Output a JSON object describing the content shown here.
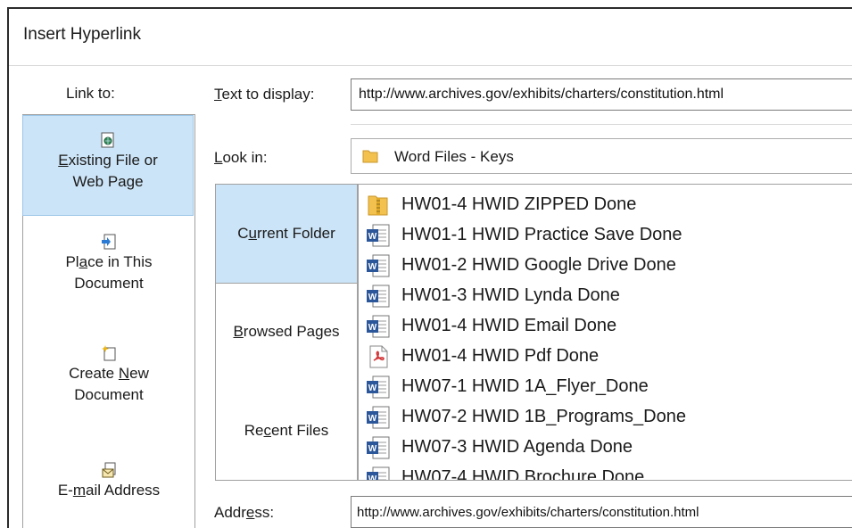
{
  "dialog": {
    "title": "Insert Hyperlink"
  },
  "link_to": {
    "label": "Link to:",
    "items": [
      {
        "line1": "Existing File or",
        "line2": "Web Page",
        "icon": "web-page-icon",
        "selected": true
      },
      {
        "line1": "Place in This",
        "line2": "Document",
        "icon": "place-in-document-icon",
        "selected": false
      },
      {
        "line1": "Create New",
        "line2": "Document",
        "icon": "new-document-icon",
        "selected": false
      },
      {
        "line1": "E-mail Address",
        "line2": "",
        "icon": "email-icon",
        "selected": false
      }
    ]
  },
  "text_to_display": {
    "label": "Text to display:",
    "value": "http://www.archives.gov/exhibits/charters/constitution.html"
  },
  "look_in": {
    "label": "Look in:",
    "value": "Word Files - Keys",
    "icon": "folder-icon"
  },
  "nav": {
    "items": [
      {
        "label": "Current Folder",
        "selected": true
      },
      {
        "label": "Browsed Pages",
        "selected": false
      },
      {
        "label": "Recent Files",
        "selected": false
      }
    ]
  },
  "files": [
    {
      "name": "HW01-4 HWID ZIPPED Done",
      "icon": "zip-folder-icon"
    },
    {
      "name": "HW01-1 HWID Practice Save Done",
      "icon": "word-doc-icon"
    },
    {
      "name": "HW01-2 HWID Google Drive Done",
      "icon": "word-doc-icon"
    },
    {
      "name": "HW01-3 HWID Lynda Done",
      "icon": "word-doc-icon"
    },
    {
      "name": "HW01-4 HWID Email Done",
      "icon": "word-doc-icon"
    },
    {
      "name": "HW01-4 HWID Pdf Done",
      "icon": "pdf-icon"
    },
    {
      "name": "HW07-1 HWID 1A_Flyer_Done",
      "icon": "word-doc-icon"
    },
    {
      "name": "HW07-2 HWID 1B_Programs_Done",
      "icon": "word-doc-icon"
    },
    {
      "name": "HW07-3 HWID Agenda Done",
      "icon": "word-doc-icon"
    },
    {
      "name": "HW07-4 HWID Brochure Done",
      "icon": "word-doc-icon"
    }
  ],
  "address": {
    "label": "Address:",
    "value": "http://www.archives.gov/exhibits/charters/constitution.html"
  },
  "colors": {
    "selection": "#cce4f7",
    "word_blue": "#2b579a",
    "pdf_red": "#d13438",
    "folder_yellow": "#f2c14e"
  }
}
